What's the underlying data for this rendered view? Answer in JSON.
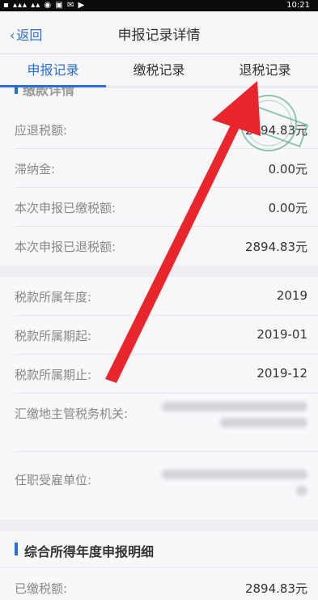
{
  "status": {
    "time": "10:21"
  },
  "nav": {
    "back_label": "返回",
    "title": "申报记录详情"
  },
  "tabs": [
    {
      "label": "申报记录"
    },
    {
      "label": "缴税记录"
    },
    {
      "label": "退税记录"
    }
  ],
  "section1": {
    "title": "缴款详情",
    "rows": [
      {
        "label": "应退税额:",
        "value": "2894.83元"
      },
      {
        "label": "滞纳金:",
        "value": "0.00元"
      },
      {
        "label": "本次申报已缴税额:",
        "value": "0.00元"
      },
      {
        "label": "本次申报已退税额:",
        "value": "2894.83元"
      }
    ]
  },
  "section2": {
    "rows": [
      {
        "label": "税款所属年度:",
        "value": "2019"
      },
      {
        "label": "税款所属期起:",
        "value": "2019-01"
      },
      {
        "label": "税款所属期止:",
        "value": "2019-12"
      },
      {
        "label": "汇缴地主管税务机关:",
        "value": ""
      },
      {
        "label": "任职受雇单位:",
        "value": ""
      }
    ]
  },
  "section3": {
    "title": "综合所得年度申报明细",
    "rows": [
      {
        "label": "已缴税额:",
        "value": "2894.83元"
      }
    ]
  },
  "colors": {
    "accent": "#2a6fd3",
    "arrow": "#e8262b",
    "stamp": "#4aa77a"
  },
  "icons": {
    "back": "chevron-left-icon"
  }
}
